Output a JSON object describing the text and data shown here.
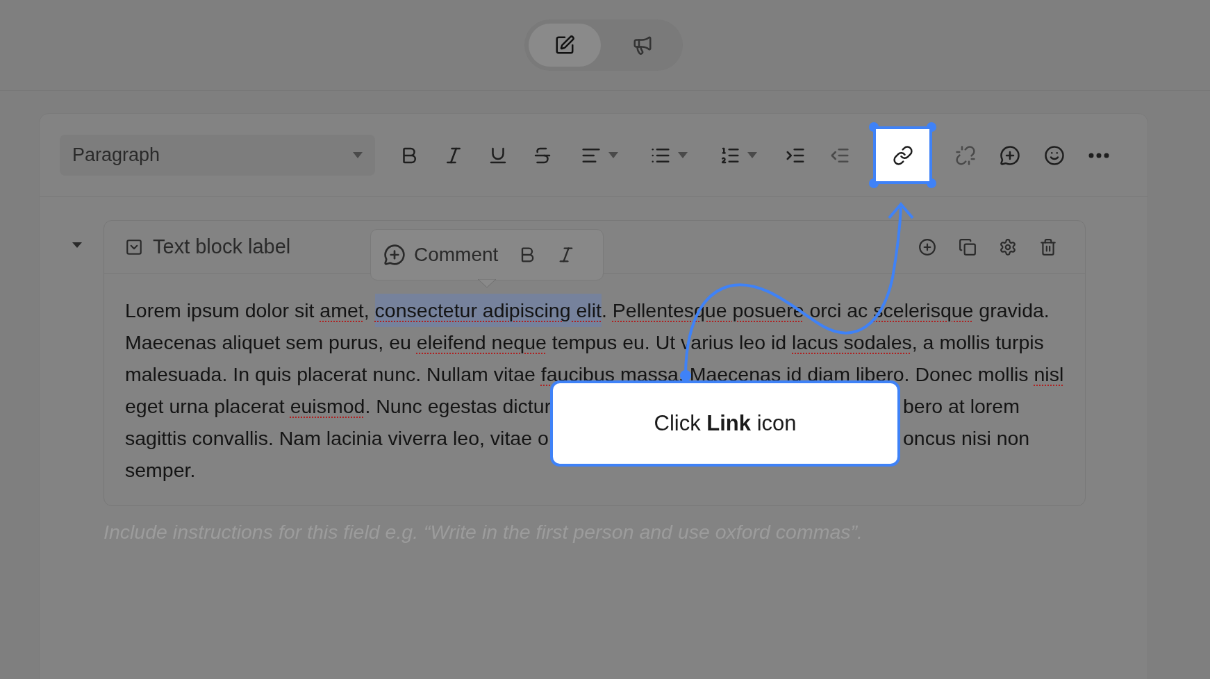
{
  "mode_switch": [
    {
      "kind": "edit",
      "selected": true
    },
    {
      "kind": "announce",
      "selected": false
    }
  ],
  "toolbar": {
    "block_type": "Paragraph",
    "tools": [
      {
        "kind": "bold",
        "highlighted": false
      },
      {
        "kind": "italic",
        "highlighted": false
      },
      {
        "kind": "underline",
        "highlighted": false
      },
      {
        "kind": "strikethrough",
        "highlighted": false
      },
      {
        "kind": "align",
        "highlighted": false
      },
      {
        "kind": "bullets",
        "highlighted": false
      },
      {
        "kind": "numbered",
        "highlighted": false
      },
      {
        "kind": "indent",
        "highlighted": false
      },
      {
        "kind": "outdent",
        "highlighted": false
      },
      {
        "kind": "link",
        "highlighted": true
      },
      {
        "kind": "unlink",
        "highlighted": false
      },
      {
        "kind": "comment",
        "highlighted": false
      },
      {
        "kind": "emoji",
        "highlighted": false
      },
      {
        "kind": "more",
        "highlighted": false
      }
    ]
  },
  "block": {
    "expanded": true,
    "label": "Text block label",
    "lines": [
      {
        "fragments": [
          [
            {
              "text": "Lorem ipsum dolor sit ",
              "kind": "plain"
            },
            {
              "text": "amet",
              "kind": "misspelled"
            },
            {
              "text": ", ",
              "kind": "plain"
            },
            {
              "text": "consectetur adipiscing elit",
              "kind": "selected"
            },
            {
              "text": ". ",
              "kind": "plain"
            },
            {
              "text": "Pellentesque posuere",
              "kind": "misspelled"
            },
            {
              "text": " orci ac ",
              "kind": "plain"
            },
            {
              "text": "scelerisque",
              "kind": "misspelled"
            },
            {
              "text": " gravida.",
              "kind": "plain"
            }
          ]
        ]
      },
      {
        "fragments": [
          [
            {
              "text": "Maecenas aliquet sem purus, eu ",
              "kind": "plain"
            },
            {
              "text": "eleifend neque",
              "kind": "misspelled"
            },
            {
              "text": " tempus eu. Ut varius leo id ",
              "kind": "plain"
            },
            {
              "text": "lacus sodales",
              "kind": "misspelled"
            },
            {
              "text": ", a mollis turpis",
              "kind": "plain"
            }
          ]
        ]
      },
      {
        "fragments": [
          [
            {
              "text": "malesuada. In quis placerat nunc. Nullam vitae ",
              "kind": "plain"
            },
            {
              "text": "faucibus",
              "kind": "misspelled"
            },
            {
              "text": " massa. Maecenas id diam libero. Donec mollis ",
              "kind": "plain"
            },
            {
              "text": "nisl",
              "kind": "misspelled"
            }
          ]
        ]
      },
      {
        "fragments": [
          [
            {
              "text": "eget urna placerat ",
              "kind": "plain"
            },
            {
              "text": "euismod",
              "kind": "misspelled"
            },
            {
              "text": ". Nunc egestas dictur",
              "kind": "plain"
            }
          ],
          [
            {
              "text": "bero at lorem",
              "kind": "plain"
            }
          ]
        ]
      },
      {
        "fragments": [
          [
            {
              "text": "sagittis convallis. Nam lacinia viverra leo, vitae o",
              "kind": "plain"
            }
          ],
          [
            {
              "text": "oncus nisi non",
              "kind": "plain"
            }
          ]
        ]
      },
      {
        "fragments": [
          [
            {
              "text": "semper.",
              "kind": "plain"
            }
          ]
        ]
      }
    ]
  },
  "inline_toolbar": {
    "comment": "Comment"
  },
  "instructions_placeholder": "Include instructions for this field e.g. “Write in the first person and use oxford commas”.",
  "callout": {
    "text": "Click **Link** icon"
  }
}
